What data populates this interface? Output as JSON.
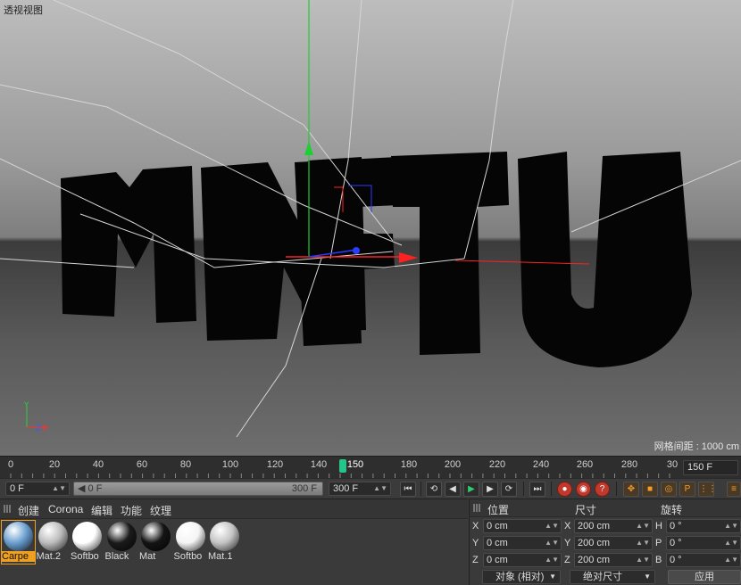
{
  "viewport": {
    "title": "透视视图",
    "grid_distance": "网格间距 : 1000 cm",
    "axis_y": "Y",
    "axis_z": "Z",
    "axis_x": "X",
    "scene_text": "MKFTU"
  },
  "timeline": {
    "ticks": [
      "0",
      "20",
      "40",
      "60",
      "80",
      "100",
      "120",
      "140",
      "150",
      "180",
      "200",
      "220",
      "240",
      "260",
      "280",
      "30"
    ],
    "current_frame": "150 F"
  },
  "transport": {
    "start_field": "0 F",
    "range_start": "0 F",
    "range_end": "300 F",
    "end_field": "300 F"
  },
  "material_menu": [
    "创建",
    "Corona",
    "编辑",
    "功能",
    "纹理"
  ],
  "materials": [
    {
      "label": "Carpe",
      "color": "#6a9fd0",
      "selected": true
    },
    {
      "label": "Mat.2",
      "color": "#bcbcbc",
      "selected": false
    },
    {
      "label": "Softbo",
      "color": "#ffffff",
      "selected": false
    },
    {
      "label": "Black",
      "color": "#1a1a1a",
      "selected": false
    },
    {
      "label": "Mat",
      "color": "#141414",
      "selected": false
    },
    {
      "label": "Softbo",
      "color": "#f4f4f4",
      "selected": false
    },
    {
      "label": "Mat.1",
      "color": "#c4c4c4",
      "selected": false
    }
  ],
  "coords": {
    "headers": {
      "position": "位置",
      "size": "尺寸",
      "rotation": "旋转"
    },
    "rows": [
      {
        "axis": "X",
        "pos": "0 cm",
        "size_axis": "X",
        "size": "200 cm",
        "rot_axis": "H",
        "rot": "0 °"
      },
      {
        "axis": "Y",
        "pos": "0 cm",
        "size_axis": "Y",
        "size": "200 cm",
        "rot_axis": "P",
        "rot": "0 °"
      },
      {
        "axis": "Z",
        "pos": "0 cm",
        "size_axis": "Z",
        "size": "200 cm",
        "rot_axis": "B",
        "rot": "0 °"
      }
    ],
    "mode_dropdown": "对象 (相对)",
    "size_dropdown": "绝对尺寸",
    "apply": "应用"
  }
}
